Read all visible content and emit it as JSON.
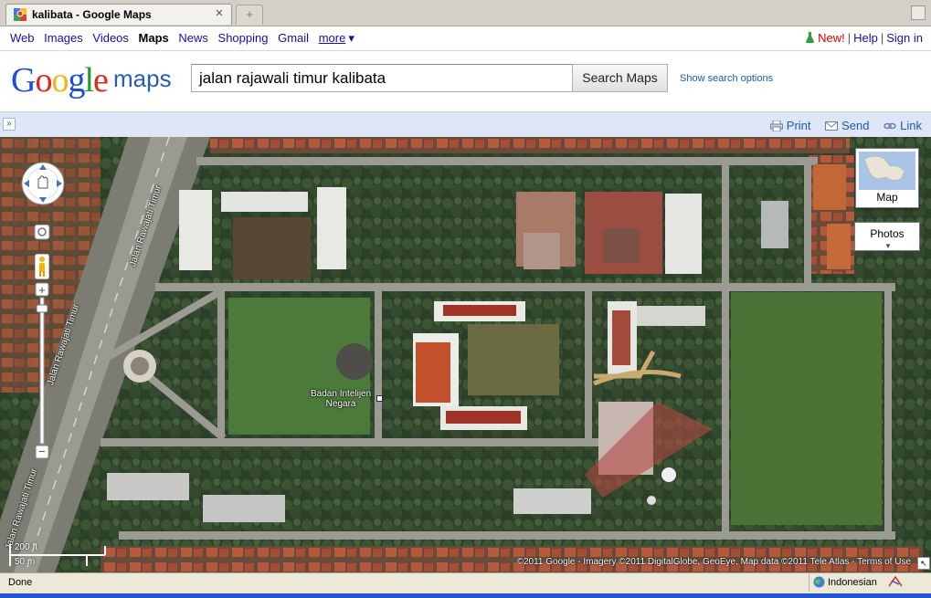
{
  "browser": {
    "tab_title": "kalibata - Google Maps",
    "new_tab_symbol": "+",
    "status": "Done",
    "language": "Indonesian"
  },
  "gbar": {
    "links": [
      "Web",
      "Images",
      "Videos",
      "Maps",
      "News",
      "Shopping",
      "Gmail"
    ],
    "active": "Maps",
    "more": "more",
    "more_arrow": "▾",
    "new_label": "New!",
    "help": "Help",
    "signin": "Sign in",
    "separator": "|"
  },
  "header": {
    "logo_letters": [
      "G",
      "o",
      "o",
      "g",
      "l",
      "e"
    ],
    "logo_product": "maps",
    "search_value": "jalan rajawali timur kalibata",
    "search_button": "Search Maps",
    "search_options": "Show search options"
  },
  "toolbar": {
    "collapse": "»",
    "print": "Print",
    "send": "Send",
    "link": "Link"
  },
  "map": {
    "map_type_map": "Map",
    "map_type_photos": "Photos",
    "place_label": "Badan Intelijen\nNegara",
    "road_labels": [
      "Jalan Rawajati Timur",
      "Jalan Rawajati Timur",
      "Jalan Rawajati Timur"
    ],
    "scale_ft": "200 ft",
    "scale_m": "50 m",
    "copyright": "©2011 Google - Imagery ©2011 DigitalGlobe, GeoEye, Map data ©2011 Tele Atlas - Terms of Use",
    "zoom_in": "+",
    "zoom_out": "−"
  },
  "colors": {
    "link": "#1a0dab",
    "accent_blue": "#1a5bb8",
    "toolbar_bg": "#dfe6f5",
    "new_red": "#dd0000"
  }
}
